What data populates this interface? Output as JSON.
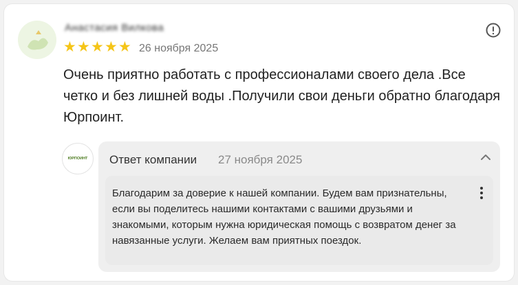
{
  "review": {
    "author_name": "Анастасия Вилкова",
    "rating": 5,
    "stars": [
      "★",
      "★",
      "★",
      "★",
      "★"
    ],
    "date": "26 ноября 2025",
    "text": "Очень приятно работать с профессионалами своего дела .Все четко и без лишней воды .Получили свои деньги обратно благодаря Юрпоинт.",
    "report_icon": "alert-circle-icon"
  },
  "company_reply": {
    "logo_text": "ЮРПОИНТ",
    "title": "Ответ компании",
    "date": "27 ноября 2025",
    "collapse_icon": "chevron-up-icon",
    "more_icon": "more-vertical-icon",
    "text": "Благодарим за доверие к нашей компании. Будем вам признательны, если вы поделитесь нашими контактами с вашими друзьями и знакомыми, которым нужна юридическая помощь с возвратом денег за навязанные услуги. Желаем вам приятных поездок."
  },
  "colors": {
    "star": "#f5c518",
    "reply_background": "#efefef",
    "brand_green": "#4b7a1e"
  }
}
